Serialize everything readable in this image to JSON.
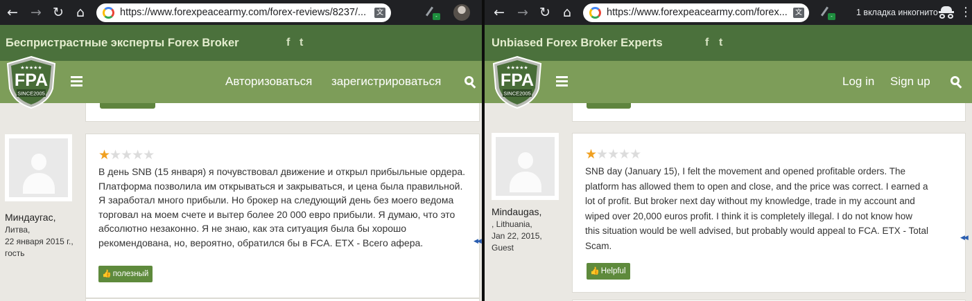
{
  "panes": {
    "left": {
      "browser": {
        "url": "https://www.forexpeacearmy.com/forex-reviews/8237/..."
      },
      "site": {
        "tagline": "Беспристрастные эксперты Forex Broker",
        "social": {
          "facebook": "f",
          "twitter": "t"
        },
        "logo": {
          "text": "FPA",
          "since": "SINCE2005",
          "stars": "★★★★★"
        },
        "nav": {
          "login": "Авторизоваться",
          "signup": "зарегистрироваться"
        }
      },
      "review": {
        "rating": {
          "value": 1,
          "max": 5,
          "filled": "★",
          "empty": "★★★★"
        },
        "lines": [
          "В день SNB (15 января) я почувствовал движение и открыл прибыльные ордера.",
          "Платформа позволила им открываться и закрываться, и цена была правильной.",
          "Я заработал много прибыли. Но брокер на следующий день без моего ведома",
          "торговал на моем счете и вытер более 20 000 евро прибыли. Я думаю, что это",
          "абсолютно незаконно. Я не знаю, как эта ситуация была бы хорошо",
          "рекомендована, но, вероятно, обратился бы в FCA. ETX - Всего афера."
        ],
        "helpful_label": "полезный",
        "reviewer": {
          "name": "Миндаугас,",
          "location": "Литва,",
          "date": "22 января 2015 г.,",
          "role": "гость"
        }
      }
    },
    "right": {
      "browser": {
        "url": "https://www.forexpeacearmy.com/forex...",
        "incognito": "1 вкладка инкогнито"
      },
      "site": {
        "tagline": "Unbiased Forex Broker Experts",
        "social": {
          "facebook": "f",
          "twitter": "t"
        },
        "logo": {
          "text": "FPA",
          "since": "SINCE2005",
          "stars": "★★★★★"
        },
        "nav": {
          "login": "Log in",
          "signup": "Sign up"
        }
      },
      "review": {
        "rating": {
          "value": 1,
          "max": 5,
          "filled": "★",
          "empty": "★★★★"
        },
        "lines": [
          "SNB day (January 15), I felt the movement and opened profitable orders. The",
          "platform has allowed them to open and close, and the price was correct. I earned a",
          "lot of profit. But broker next day without my knowledge, trade in my account and",
          "wiped over 20,000 euros profit. I think it is completely illegal. I do not know how",
          "this situation would be well advised, but probably would appeal to FCA. ETX - Total",
          "Scam."
        ],
        "helpful_label": "Helpful",
        "reviewer": {
          "name": "Mindaugas,",
          "location": ", Lithuania,",
          "date": "Jan 22, 2015,",
          "role": "Guest"
        }
      }
    }
  },
  "icons": {
    "back": "←",
    "forward": "→",
    "reload": "↻",
    "home": "⌂",
    "menu": "⋮",
    "translate": "文",
    "thumbs_up": "👍",
    "scroll_arrow": "◀◀"
  },
  "colors": {
    "chrome_toolbar": "#202124",
    "topbar": "#4b713c",
    "navbar": "#7d9d59",
    "tagline": "#e4edcf",
    "page_bg": "#eae8e3",
    "helpful_button": "#5e8a3c",
    "star_on": "#f0a020",
    "star_off": "#dcdcdc"
  }
}
